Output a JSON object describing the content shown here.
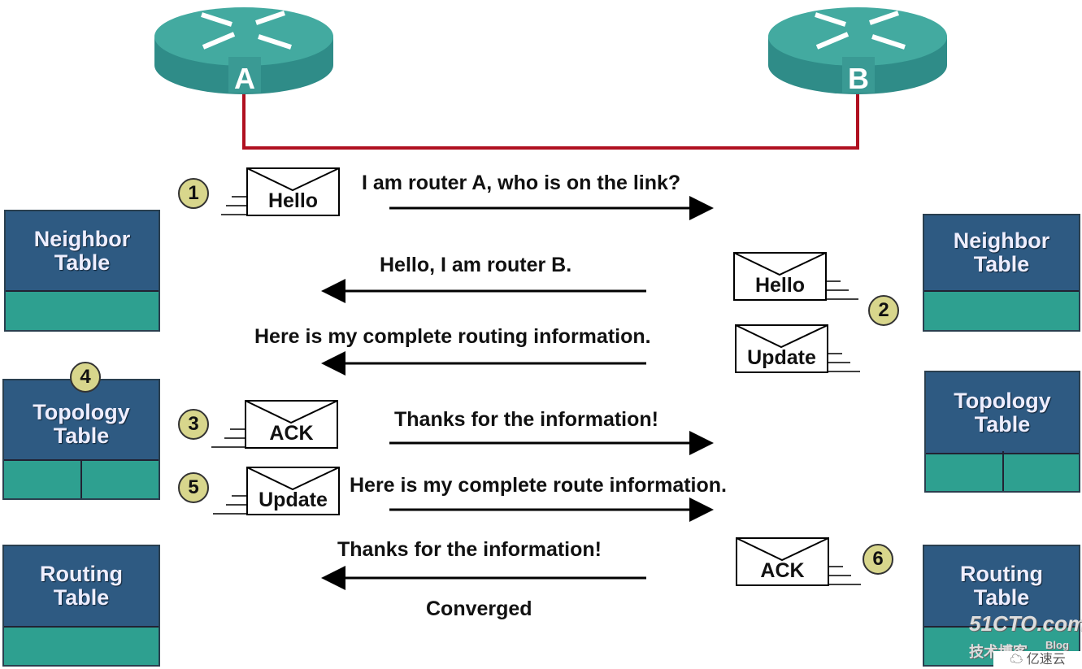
{
  "routers": [
    {
      "label": "A"
    },
    {
      "label": "B"
    }
  ],
  "colors": {
    "link": "#b01020",
    "router": "#3a9a94",
    "table_header": "#2e5a82",
    "table_body": "#2ea090",
    "step_badge": "#d8d68c"
  },
  "left_tables": [
    {
      "title": "Neighbor Table",
      "line1": "Neighbor",
      "line2": "Table"
    },
    {
      "title": "Topology Table",
      "line1": "Topology",
      "line2": "Table"
    },
    {
      "title": "Routing Table",
      "line1": "Routing",
      "line2": "Table"
    }
  ],
  "right_tables": [
    {
      "line1": "Neighbor",
      "line2": "Table"
    },
    {
      "line1": "Topology",
      "line2": "Table"
    },
    {
      "line1": "Routing",
      "line2": "Table"
    }
  ],
  "steps": [
    {
      "number": "1",
      "packet": "Hello",
      "message": "I am router A, who is on the link?",
      "direction": "A-to-B"
    },
    {
      "number": "2",
      "packet": "Hello",
      "message": "Hello, I am router B.",
      "direction": "B-to-A"
    },
    {
      "packet": "Update",
      "message": "Here is my complete routing information.",
      "direction": "B-to-A"
    },
    {
      "number": "3",
      "packet": "ACK",
      "message": "Thanks for the information!",
      "direction": "A-to-B"
    },
    {
      "number": "4"
    },
    {
      "number": "5",
      "packet": "Update",
      "message": "Here is my complete route information.",
      "direction": "A-to-B"
    },
    {
      "number": "6",
      "packet": "ACK",
      "message": "Thanks for the information!",
      "direction": "B-to-A"
    }
  ],
  "footer": "Converged",
  "watermark": {
    "site": "51CTO.com",
    "sub": "技术博客",
    "blog": "Blog",
    "brand": "亿速云"
  }
}
